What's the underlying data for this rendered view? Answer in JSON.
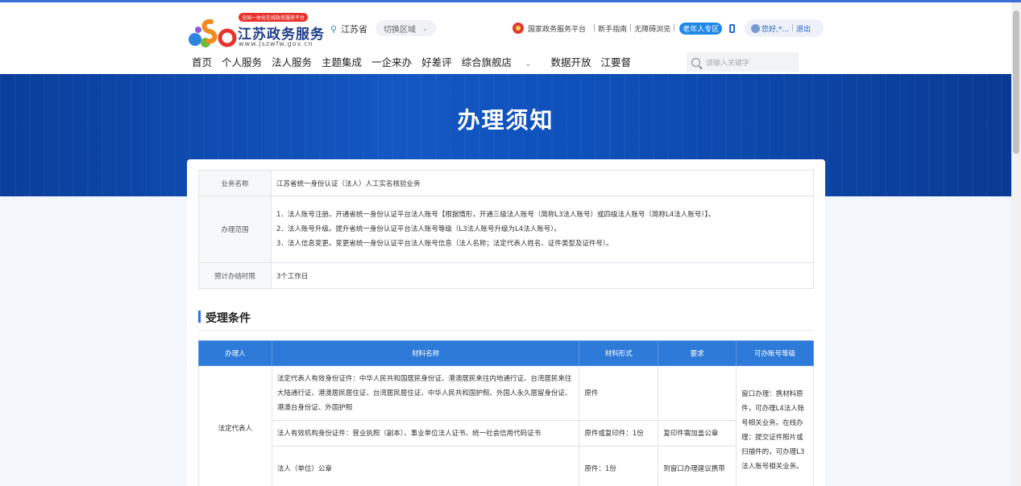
{
  "logo": {
    "badge": "全国一体化在线政务服务平台",
    "title": "江苏政务服务",
    "url": "www.jszwfw.gov.cn"
  },
  "location": {
    "province": "江苏省",
    "switch_label": "切换区域"
  },
  "top_links": {
    "national": "国家政务服务平台",
    "guide": "新手指南",
    "accessible": "无障碍浏览",
    "elder": "老年人专区"
  },
  "user": {
    "greeting": "您好,*...",
    "logout": "退出"
  },
  "nav": [
    "首页",
    "个人服务",
    "法人服务",
    "主题集成",
    "一企来办",
    "好差评",
    "综合旗舰店",
    "数据开放",
    "江要督"
  ],
  "search": {
    "placeholder": "请输入关键字"
  },
  "banner": {
    "title": "办理须知"
  },
  "info": {
    "name_label": "业务名称",
    "name_value": "江苏省统一身份认证（法人）人工实名核验业务",
    "scope_label": "办理范围",
    "scope_items": [
      "1．法人账号注册。开通省统一身份认证平台法人账号【根据情形，开通三级法人账号（简称L3法人账号）或四级法人账号（简称L4法人账号）】。",
      "2．法人账号升级。提升省统一身份认证平台法人账号等级（L3法人账号升级为L4法人账号）。",
      "3．法人信息变更。变更省统一身份认证平台法人账号信息（法人名称；法定代表人姓名、证件类型及证件号）。"
    ],
    "time_label": "预计办结时限",
    "time_value": "3个工作日"
  },
  "section": {
    "title": "受理条件"
  },
  "materials": {
    "headers": [
      "办理人",
      "材料名称",
      "材料形式",
      "要求",
      "可办账号等级"
    ],
    "handler": "法定代表人",
    "rows": [
      {
        "name": "法定代表人有效身份证件：中华人民共和国居民身份证、港澳居民来往内地通行证、台湾居民来往大陆通行证、港澳居民居住证、台湾居民居住证、中华人民共和国护照、外国人永久居留身份证、港澳台身份证、外国护照",
        "form": "原件",
        "req": ""
      },
      {
        "name": "法人有效机构身份证件：营业执照（副本）、事业单位法人证书、统一社会信用代码证书",
        "form": "原件或复印件：1份",
        "req": "复印件需加盖公章"
      },
      {
        "name": "法人（单位）公章",
        "form": "原件：1份",
        "req": "到窗口办理建议携带"
      }
    ],
    "level_text": "窗口办理：携材料原件，可办理L4法人账号相关业务。在线办理：提交证件照片或扫描件的，可办理L3法人账号相关业务。"
  }
}
